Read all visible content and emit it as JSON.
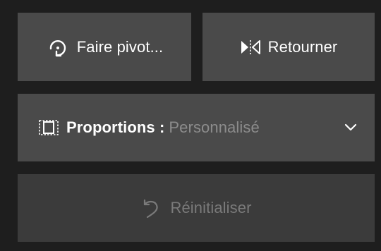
{
  "panel": {
    "rotate": {
      "label": "Faire pivot...",
      "icon": "rotate-icon"
    },
    "flip": {
      "label": "Retourner",
      "icon": "flip-icon"
    },
    "aspect_ratio": {
      "label": "Proportions :",
      "value": "Personnalisé",
      "icon": "aspect-ratio-icon",
      "dropdown_icon": "chevron-down-icon"
    },
    "reset": {
      "label": "Réinitialiser",
      "icon": "undo-icon",
      "enabled": false
    }
  },
  "colors": {
    "background": "#1e1e1e",
    "button": "#4a4a4a",
    "button_disabled": "#3b3b3b",
    "text": "#ffffff",
    "text_muted": "#8c8c8c",
    "text_disabled": "#7a7a7a"
  }
}
